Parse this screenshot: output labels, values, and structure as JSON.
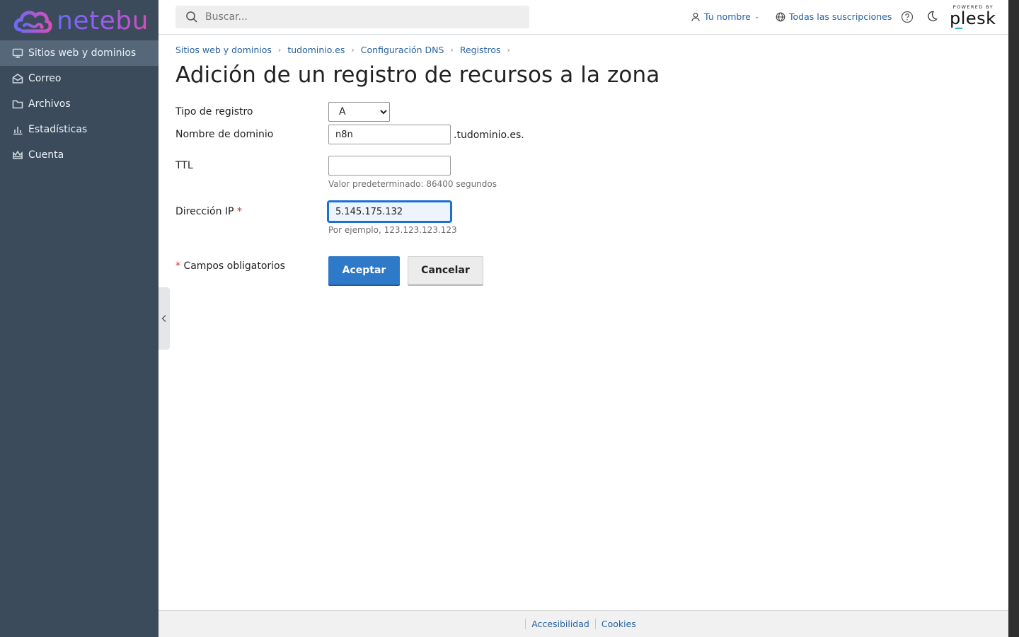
{
  "brand": {
    "name": "netebu",
    "logo_icon": "cloud-infinity-logo"
  },
  "sidebar": {
    "items": [
      {
        "label": "Sitios web y dominios",
        "icon": "monitor-icon",
        "active": true
      },
      {
        "label": "Correo",
        "icon": "mail-open-icon"
      },
      {
        "label": "Archivos",
        "icon": "folder-icon"
      },
      {
        "label": "Estadísticas",
        "icon": "bar-chart-icon"
      },
      {
        "label": "Cuenta",
        "icon": "crown-icon"
      }
    ]
  },
  "header": {
    "search_placeholder": "Buscar...",
    "user_label": "Tu nombre",
    "subscriptions_label": "Todas las suscripciones",
    "powered_by": "POWERED BY",
    "plesk": "plesk"
  },
  "breadcrumb": [
    "Sitios web y dominios",
    "tudominio.es",
    "Configuración DNS",
    "Registros"
  ],
  "page_title": "Adición de un registro de recursos a la zona",
  "form": {
    "record_type_label": "Tipo de registro",
    "record_type_value": "A",
    "record_type_options": [
      "A"
    ],
    "domain_name_label": "Nombre de dominio",
    "domain_name_value": "n8n",
    "domain_suffix": ".tudominio.es.",
    "ttl_label": "TTL",
    "ttl_value": "",
    "ttl_hint": "Valor predeterminado: 86400 segundos",
    "ip_label": "Dirección IP",
    "ip_required_mark": "*",
    "ip_value": "5.145.175.132",
    "ip_hint": "Por ejemplo, 123.123.123.123",
    "required_note_mark": "*",
    "required_note": "Campos obligatorios",
    "ok_label": "Aceptar",
    "cancel_label": "Cancelar"
  },
  "footer": {
    "links": [
      "Accesibilidad",
      "Cookies"
    ]
  },
  "colors": {
    "sidebar_bg": "#3b4b5c",
    "sidebar_active": "#56677a",
    "link": "#28629f",
    "primary_button": "#2f79c9",
    "required": "#d02e26"
  }
}
